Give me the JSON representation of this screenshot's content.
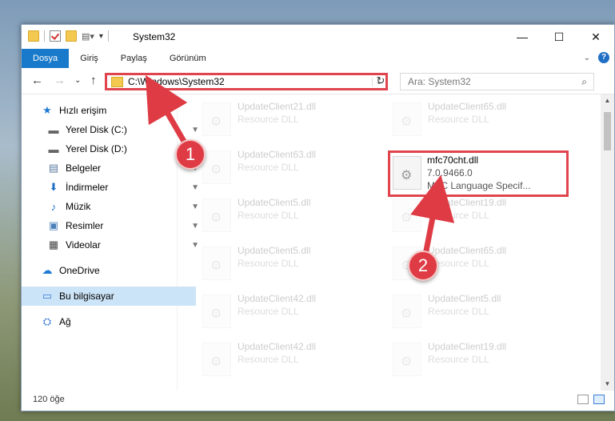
{
  "window": {
    "title": "System32",
    "controls": {
      "minimize": "—",
      "maximize": "☐",
      "close": "✕"
    }
  },
  "ribbon": {
    "tabs": [
      "Dosya",
      "Giriş",
      "Paylaş",
      "Görünüm"
    ],
    "active_tab": "Dosya",
    "help": "?"
  },
  "navigation": {
    "back": "←",
    "forward": "→",
    "recent": "⌄",
    "up": "↑",
    "address": "C:\\Windows\\System32",
    "address_dropdown": "⌄",
    "refresh": "↻",
    "search_placeholder": "Ara: System32",
    "search_icon": "⌕"
  },
  "sidebar": {
    "items": [
      {
        "label": "Hızlı erişim",
        "icon": "star-icon",
        "glyph": "★",
        "pinned": false
      },
      {
        "label": "Yerel Disk (C:)",
        "icon": "drive-icon",
        "glyph": "▬",
        "pinned": true
      },
      {
        "label": "Yerel Disk (D:)",
        "icon": "drive-icon",
        "glyph": "▬",
        "pinned": true
      },
      {
        "label": "Belgeler",
        "icon": "documents-icon",
        "glyph": "▤",
        "pinned": true
      },
      {
        "label": "İndirmeler",
        "icon": "download-icon",
        "glyph": "⬇",
        "pinned": true
      },
      {
        "label": "Müzik",
        "icon": "music-icon",
        "glyph": "♪",
        "pinned": true
      },
      {
        "label": "Resimler",
        "icon": "pictures-icon",
        "glyph": "▣",
        "pinned": true
      },
      {
        "label": "Videolar",
        "icon": "videos-icon",
        "glyph": "▦",
        "pinned": true
      },
      {
        "label": "OneDrive",
        "icon": "cloud-icon",
        "glyph": "☁",
        "pinned": false
      },
      {
        "label": "Bu bilgisayar",
        "icon": "computer-icon",
        "glyph": "▭",
        "pinned": false,
        "selected": true
      },
      {
        "label": "Ağ",
        "icon": "network-icon",
        "glyph": "⛭",
        "pinned": false
      }
    ],
    "pin_glyph": "📌"
  },
  "files": [
    {
      "name": "UpdateClient21.dll",
      "line2": "Resource DLL",
      "line3": "",
      "faded": true
    },
    {
      "name": "UpdateClient65.dll",
      "line2": "Resource DLL",
      "line3": "",
      "faded": true
    },
    {
      "name": "UpdateClient63.dll",
      "line2": "Resource DLL",
      "line3": "",
      "faded": true
    },
    {
      "name": "mfc70cht.dll",
      "line2": "7.0.9466.0",
      "line3": "MFC Language Specif...",
      "faded": false,
      "highlighted": true
    },
    {
      "name": "UpdateClient5.dll",
      "line2": "Resource DLL",
      "line3": "",
      "faded": true
    },
    {
      "name": "UpdateClient19.dll",
      "line2": "Resource DLL",
      "line3": "",
      "faded": true
    },
    {
      "name": "UpdateClient5.dll",
      "line2": "Resource DLL",
      "line3": "",
      "faded": true
    },
    {
      "name": "UpdateClient65.dll",
      "line2": "Resource DLL",
      "line3": "",
      "faded": true
    },
    {
      "name": "UpdateClient42.dll",
      "line2": "Resource DLL",
      "line3": "",
      "faded": true
    },
    {
      "name": "UpdateClient5.dll",
      "line2": "Resource DLL",
      "line3": "",
      "faded": true
    },
    {
      "name": "UpdateClient42.dll",
      "line2": "Resource DLL",
      "line3": "",
      "faded": true
    },
    {
      "name": "UpdateClient19.dll",
      "line2": "Resource DLL",
      "line3": "",
      "faded": true
    }
  ],
  "status": {
    "count": "120 öğe"
  },
  "annotations": [
    {
      "number": "1",
      "color": "#df3b45"
    },
    {
      "number": "2",
      "color": "#df3b45"
    }
  ]
}
